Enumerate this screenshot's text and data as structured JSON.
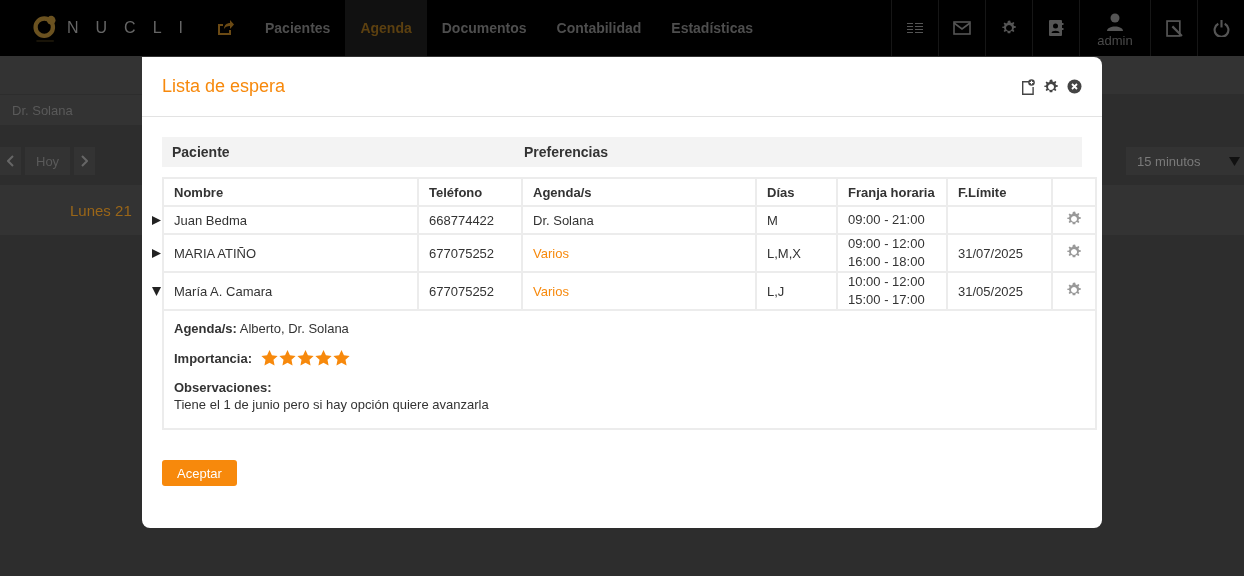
{
  "app": {
    "logo_text": "NUCLI",
    "nav": [
      {
        "label": "Pacientes",
        "selected": false
      },
      {
        "label": "Agenda",
        "selected": true
      },
      {
        "label": "Documentos",
        "selected": false
      },
      {
        "label": "Contabilidad",
        "selected": false
      },
      {
        "label": "Estadísticas",
        "selected": false
      }
    ],
    "user": "admin"
  },
  "background": {
    "agenda_select": "Dr. Solana",
    "today_button": "Hoy",
    "interval_select": "15 minutos",
    "day_heading": "Lunes 21"
  },
  "dialog": {
    "title": "Lista de espera",
    "group_headers": [
      "Paciente",
      "Preferencias"
    ],
    "columns": [
      "Nombre",
      "Teléfono",
      "Agenda/s",
      "Días",
      "Franja horaria",
      "F.Límite"
    ],
    "rows": [
      {
        "name": "Juan Bedma",
        "phone": "668774422",
        "agenda": "Dr. Solana",
        "agenda_highlighted": false,
        "days": "M",
        "time_ranges": [
          "09:00 - 21:00"
        ],
        "deadline": "",
        "expanded": false
      },
      {
        "name": "MARIA ATIÑO",
        "phone": "677075252",
        "agenda": "Varios",
        "agenda_highlighted": true,
        "days": "L,M,X",
        "time_ranges": [
          "09:00 - 12:00",
          "16:00 - 18:00"
        ],
        "deadline": "31/07/2025",
        "expanded": false
      },
      {
        "name": "María A. Camara",
        "phone": "677075252",
        "agenda": "Varios",
        "agenda_highlighted": true,
        "days": "L,J",
        "time_ranges": [
          "10:00 - 12:00",
          "15:00 - 17:00"
        ],
        "deadline": "31/05/2025",
        "expanded": true,
        "details": {
          "agendas_label": "Agenda/s:",
          "agendas": "Alberto, Dr. Solana",
          "importance_label": "Importancia:",
          "stars": 5,
          "observations_label": "Observaciones:",
          "observations": "Tiene el 1 de junio pero si hay opción quiere avanzarla"
        }
      }
    ],
    "accept_button": "Aceptar"
  }
}
